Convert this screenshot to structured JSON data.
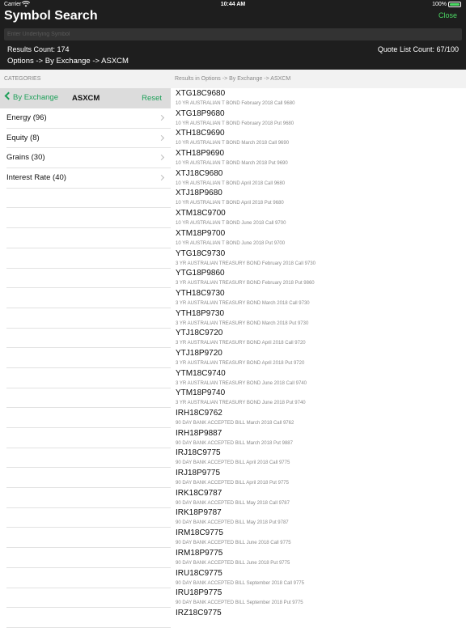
{
  "statusbar": {
    "carrier": "Carrier",
    "time": "10:44 AM",
    "battery": "100%"
  },
  "header": {
    "title": "Symbol Search",
    "close_label": "Close",
    "search_placeholder": "Enter Underlying Symbol",
    "results_count": "Results Count: 174",
    "quote_count": "Quote List Count: 67/100",
    "breadcrumb": "Options -> By Exchange -> ASXCM"
  },
  "categories": {
    "header": "CATEGORIES",
    "back_label": "By Exchange",
    "nav_title": "ASXCM",
    "reset_label": "Reset",
    "items": [
      "Energy (96)",
      "Equity (8)",
      "Grains (30)",
      "Interest Rate (40)"
    ]
  },
  "results": {
    "header": "Results in Options -> By Exchange -> ASXCM",
    "items": [
      {
        "symbol": "XTG18C9680",
        "desc": "10 YR AUSTRALIAN T BOND February 2018 Call 9680"
      },
      {
        "symbol": "XTG18P9680",
        "desc": "10 YR AUSTRALIAN T BOND February 2018 Put 9680"
      },
      {
        "symbol": "XTH18C9690",
        "desc": "10 YR AUSTRALIAN T BOND March 2018 Call 9690"
      },
      {
        "symbol": "XTH18P9690",
        "desc": "10 YR AUSTRALIAN T BOND March 2018 Put 9690"
      },
      {
        "symbol": "XTJ18C9680",
        "desc": "10 YR AUSTRALIAN T BOND April 2018 Call 9680"
      },
      {
        "symbol": "XTJ18P9680",
        "desc": "10 YR AUSTRALIAN T BOND April 2018 Put 9680"
      },
      {
        "symbol": "XTM18C9700",
        "desc": "10 YR AUSTRALIAN T BOND June 2018 Call 9700"
      },
      {
        "symbol": "XTM18P9700",
        "desc": "10 YR AUSTRALIAN T BOND June 2018 Put 9700"
      },
      {
        "symbol": "YTG18C9730",
        "desc": "3 YR AUSTRALIAN TREASURY BOND February 2018 Call 9730"
      },
      {
        "symbol": "YTG18P9860",
        "desc": "3 YR AUSTRALIAN TREASURY BOND February 2018 Put 9860"
      },
      {
        "symbol": "YTH18C9730",
        "desc": "3 YR AUSTRALIAN TREASURY BOND March 2018 Call 9730"
      },
      {
        "symbol": "YTH18P9730",
        "desc": "3 YR AUSTRALIAN TREASURY BOND March 2018 Put 9730"
      },
      {
        "symbol": "YTJ18C9720",
        "desc": "3 YR AUSTRALIAN TREASURY BOND April 2018 Call 9720"
      },
      {
        "symbol": "YTJ18P9720",
        "desc": "3 YR AUSTRALIAN TREASURY BOND April 2018 Put 9720"
      },
      {
        "symbol": "YTM18C9740",
        "desc": "3 YR AUSTRALIAN TREASURY BOND June 2018 Call 9740"
      },
      {
        "symbol": "YTM18P9740",
        "desc": "3 YR AUSTRALIAN TREASURY BOND June 2018 Put 9740"
      },
      {
        "symbol": "IRH18C9762",
        "desc": "90 DAY BANK ACCEPTED BILL March 2018 Call 9762"
      },
      {
        "symbol": "IRH18P9887",
        "desc": "90 DAY BANK ACCEPTED BILL March 2018 Put 9887"
      },
      {
        "symbol": "IRJ18C9775",
        "desc": "90 DAY BANK ACCEPTED BILL April 2018 Call 9775"
      },
      {
        "symbol": "IRJ18P9775",
        "desc": "90 DAY BANK ACCEPTED BILL April 2018 Put 9775"
      },
      {
        "symbol": "IRK18C9787",
        "desc": "90 DAY BANK ACCEPTED BILL May 2018 Call 9787"
      },
      {
        "symbol": "IRK18P9787",
        "desc": "90 DAY BANK ACCEPTED BILL May 2018 Put 9787"
      },
      {
        "symbol": "IRM18C9775",
        "desc": "90 DAY BANK ACCEPTED BILL June 2018 Call 9775"
      },
      {
        "symbol": "IRM18P9775",
        "desc": "90 DAY BANK ACCEPTED BILL June 2018 Put 9775"
      },
      {
        "symbol": "IRU18C9775",
        "desc": "90 DAY BANK ACCEPTED BILL September 2018 Call 9775"
      },
      {
        "symbol": "IRU18P9775",
        "desc": "90 DAY BANK ACCEPTED BILL September 2018 Put 9775"
      },
      {
        "symbol": "IRZ18C9775",
        "desc": ""
      }
    ]
  },
  "colors": {
    "accent": "#4cd964",
    "accent_dark": "#1fa05a",
    "header_bg": "#1e1e1e"
  },
  "icons": [
    "wifi-icon",
    "battery-icon",
    "back-chevron-icon",
    "chevron-right-icon"
  ]
}
